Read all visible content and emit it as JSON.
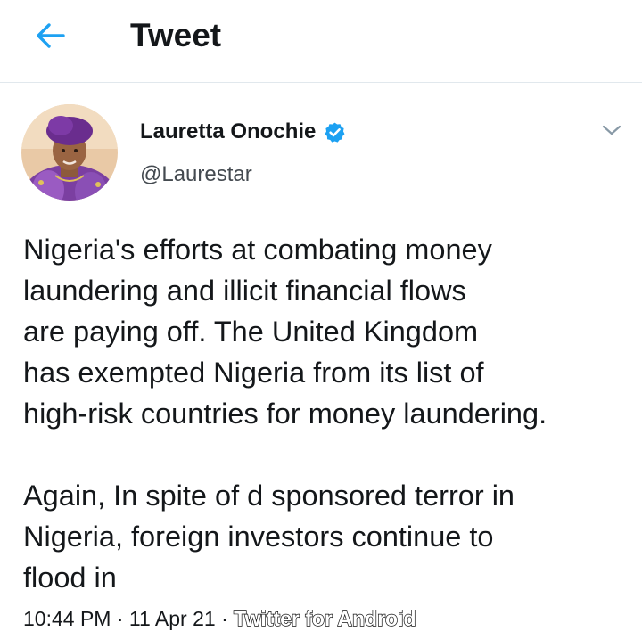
{
  "header": {
    "title": "Tweet",
    "accent_color": "#1da1f2"
  },
  "tweet": {
    "author": {
      "display_name": "Lauretta Onochie",
      "handle": "@Laurestar",
      "verified": true,
      "avatar_icon": "profile-photo"
    },
    "text": "Nigeria's efforts at combating money\nlaundering and illicit financial flows\nare paying off. The United Kingdom\nhas exempted Nigeria from its list of\nhigh-risk countries for money laundering.\n\nAgain, In spite of d sponsored terror in\nNigeria, foreign investors continue to\nflood in",
    "time": "10:44 PM",
    "date": "11 Apr 21",
    "separator": "·",
    "source": "Twitter for Android"
  },
  "icons": {
    "back": "back-arrow-icon",
    "verified": "verified-badge-icon",
    "menu": "chevron-down-icon"
  }
}
